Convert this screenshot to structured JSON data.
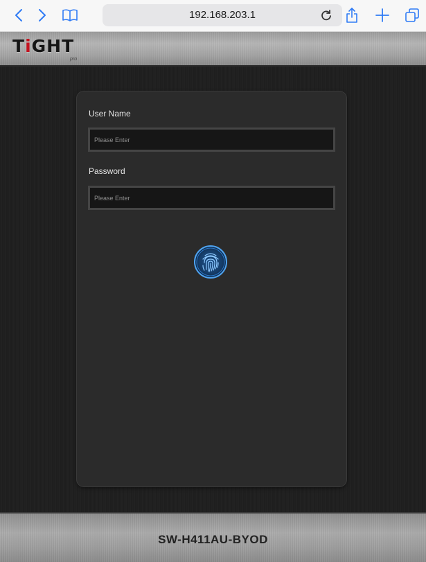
{
  "browser": {
    "url": "192.168.203.1",
    "accent_color": "#2f7bf5",
    "icons": [
      "back-icon",
      "forward-icon",
      "bookmarks-icon",
      "reload-icon",
      "share-icon",
      "new-tab-icon",
      "tabs-icon"
    ]
  },
  "header": {
    "logo_prefix": "T",
    "logo_i": "i",
    "logo_suffix": "GHT",
    "logo_sub": "pro",
    "logo_accent_color": "#c4121f"
  },
  "login": {
    "username_label": "User Name",
    "username_placeholder": "Please Enter",
    "username_value": "",
    "password_label": "Password",
    "password_placeholder": "Please Enter",
    "password_value": "",
    "login_icon": "fingerprint-icon"
  },
  "footer": {
    "model": "SW-H411AU-BYOD"
  }
}
